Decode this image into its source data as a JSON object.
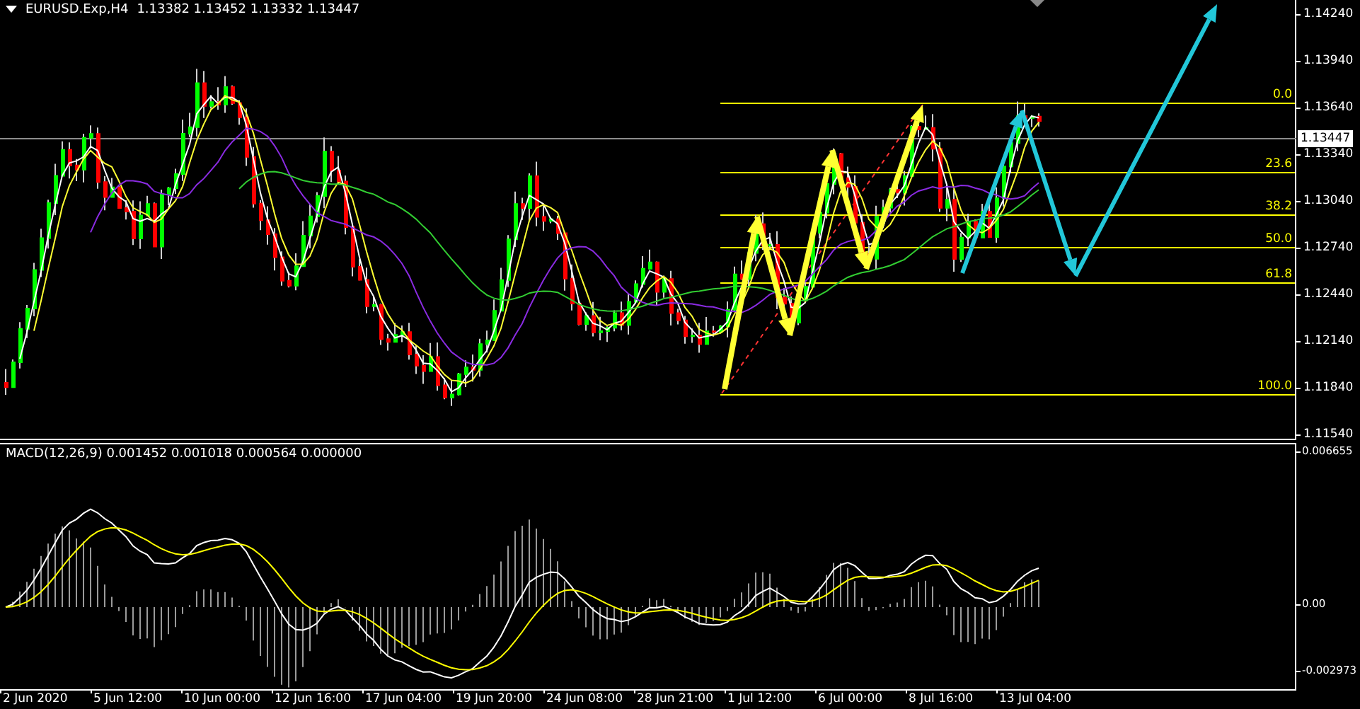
{
  "header": {
    "symbol": "EURUSD.Exp,H4",
    "quote": "1.13382 1.13452 1.13332 1.13447"
  },
  "price_axis": {
    "ticks": [
      "1.14240",
      "1.13940",
      "1.13640",
      "1.13340",
      "1.13040",
      "1.12740",
      "1.12440",
      "1.12140",
      "1.11840",
      "1.11540"
    ],
    "current_price": "1.13447"
  },
  "fibonacci": {
    "levels": [
      "0.0",
      "23.6",
      "38.2",
      "50.0",
      "61.8",
      "100.0"
    ]
  },
  "macd": {
    "label": "MACD(12,26,9) 0.001452 0.001018 0.000564 0.000000",
    "axis_ticks": [
      "0.006655",
      "0.00",
      "-0.002973"
    ]
  },
  "time_axis": {
    "labels": [
      "2 Jun 2020",
      "5 Jun 12:00",
      "10 Jun 00:00",
      "12 Jun 16:00",
      "17 Jun 04:00",
      "19 Jun 20:00",
      "24 Jun 08:00",
      "28 Jun 21:00",
      "1 Jul 12:00",
      "6 Jul 00:00",
      "8 Jul 16:00",
      "13 Jul 04:00"
    ]
  }
}
